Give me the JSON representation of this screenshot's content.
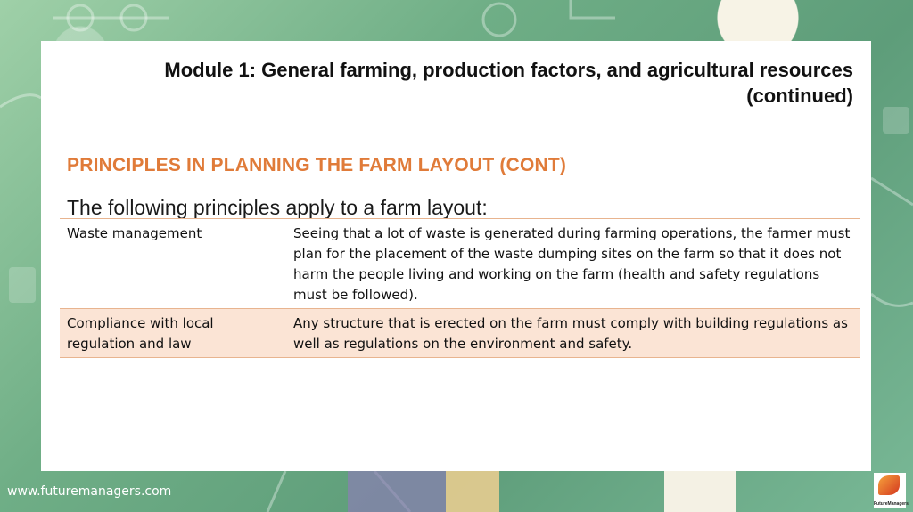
{
  "header": {
    "module_title": "Module 1:  General farming, production factors, and agricultural resources (continued)"
  },
  "content": {
    "section_heading": "PRINCIPLES IN PLANNING THE FARM LAYOUT (CONT)",
    "intro": "The following principles apply to a farm layout:",
    "rows": [
      {
        "principle": "Waste management",
        "description": "Seeing that a lot of waste is generated during farming operations, the farmer must plan for the placement of the waste dumping sites on the farm so that it does not harm the people living and working on the farm (health and safety regulations must be followed)."
      },
      {
        "principle": "Compliance with local regulation and law",
        "description": "Any structure that is erected on the farm must comply with building regulations as well as regulations on the environment and safety."
      }
    ]
  },
  "footer": {
    "url": "www.futuremanagers.com",
    "logo_text": "FutureManagers"
  },
  "colors": {
    "heading": "#e07b39",
    "row_highlight": "#fbe4d5",
    "table_border": "#e8b48f"
  }
}
